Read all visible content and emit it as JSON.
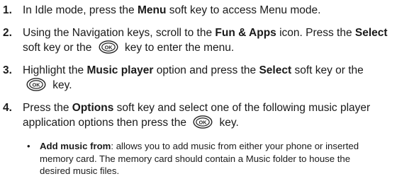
{
  "steps": [
    {
      "num": "1.",
      "lines": [
        [
          "In Idle mode, press the ",
          {
            "b": "Menu"
          },
          " soft key to access Menu mode."
        ]
      ]
    },
    {
      "num": "2.",
      "lines": [
        [
          "Using the Navigation keys, scroll to the ",
          {
            "b": "Fun & Apps"
          },
          " icon. Press the ",
          {
            "b": "Select"
          }
        ],
        [
          "soft key or the ",
          {
            "key": "OK"
          },
          " key to enter the menu."
        ]
      ]
    },
    {
      "num": "3.",
      "lines": [
        [
          "Highlight the ",
          {
            "b": "Music player"
          },
          " option and press the ",
          {
            "b": "Select"
          },
          " soft key or the"
        ],
        [
          {
            "key": "OK"
          },
          " key."
        ]
      ]
    },
    {
      "num": "4.",
      "lines": [
        [
          "Press the ",
          {
            "b": "Options"
          },
          " soft key and select one of the following music player"
        ],
        [
          "application options then press the ",
          {
            "key": "OK"
          },
          " key."
        ]
      ]
    }
  ],
  "bullet": {
    "marker": "•",
    "lines": [
      [
        {
          "b": "Add music from"
        },
        ": allows you to add music from either your phone or inserted"
      ],
      [
        "memory card. The memory card should contain a Music folder to house the"
      ],
      [
        "desired music files."
      ]
    ]
  },
  "icons": {
    "ok_key": "ok-key-icon"
  }
}
